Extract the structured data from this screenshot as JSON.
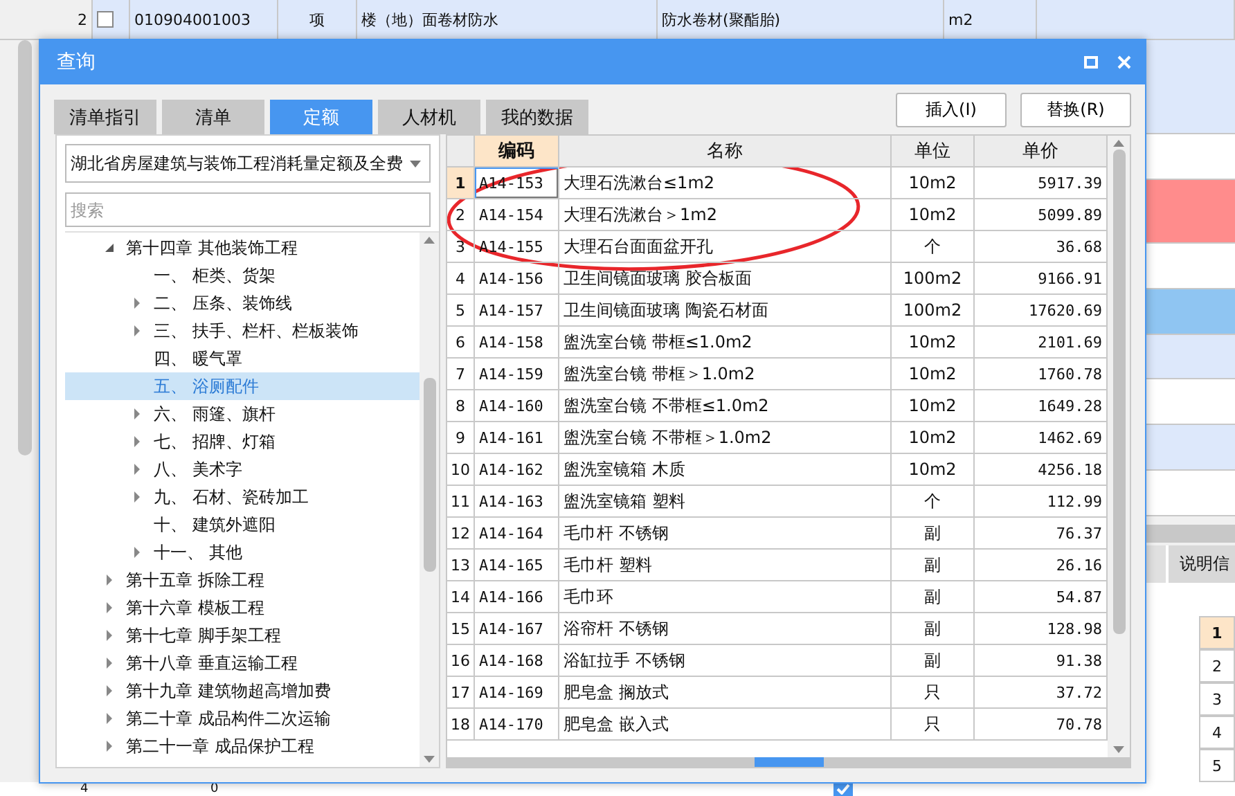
{
  "background": {
    "top_row": {
      "number": "2",
      "checked": false,
      "code": "010904001003",
      "type": "项",
      "name": "楼（地）面卷材防水",
      "feature": "防水卷材(聚酯胎)",
      "unit": "m2"
    },
    "side_rows": [
      {
        "color": "#dde8fb"
      },
      {
        "color": "#ffffff"
      },
      {
        "color": "#ff8c8c"
      },
      {
        "color": "#ffffff"
      },
      {
        "color": "#8fc5f2"
      },
      {
        "color": "#dde8fb"
      },
      {
        "color": "#ffffff"
      },
      {
        "color": "#dde8fb"
      },
      {
        "color": "#ffffff"
      }
    ],
    "side_tab": "说明信",
    "side_numbers": [
      {
        "label": "1",
        "selected": true
      },
      {
        "label": "2",
        "selected": false
      },
      {
        "label": "3",
        "selected": false
      },
      {
        "label": "4",
        "selected": false
      },
      {
        "label": "5",
        "selected": false
      }
    ],
    "bottom_row": {
      "number": "4",
      "value": "0",
      "checked": true
    }
  },
  "dialog": {
    "title": "查询",
    "tabs": [
      {
        "label": "清单指引",
        "selected": false
      },
      {
        "label": "清单",
        "selected": false
      },
      {
        "label": "定额",
        "selected": true
      },
      {
        "label": "人材机",
        "selected": false
      },
      {
        "label": "我的数据",
        "selected": false
      }
    ],
    "buttons": [
      "插入(I)",
      "替换(R)"
    ],
    "library": "湖北省房屋建筑与装饰工程消耗量定额及全费",
    "search": {
      "placeholder": "搜索"
    },
    "tree": [
      {
        "label": "第十四章 其他装饰工程",
        "expanded": true,
        "selected": false,
        "children": [
          {
            "label": "一、 柜类、货架",
            "selected": false
          },
          {
            "label": "二、 压条、装饰线",
            "expanded": false,
            "selected": false
          },
          {
            "label": "三、 扶手、栏杆、栏板装饰",
            "expanded": false,
            "selected": false
          },
          {
            "label": "四、 暖气罩",
            "selected": false
          },
          {
            "label": "五、 浴厕配件",
            "selected": true
          },
          {
            "label": "六、 雨篷、旗杆",
            "expanded": false,
            "selected": false
          },
          {
            "label": "七、 招牌、灯箱",
            "expanded": false,
            "selected": false
          },
          {
            "label": "八、 美术字",
            "expanded": false,
            "selected": false
          },
          {
            "label": "九、 石材、瓷砖加工",
            "expanded": false,
            "selected": false
          },
          {
            "label": "十、 建筑外遮阳",
            "selected": false
          },
          {
            "label": "十一、 其他",
            "expanded": false,
            "selected": false
          }
        ]
      },
      {
        "label": "第十五章 拆除工程",
        "expanded": false,
        "selected": false
      },
      {
        "label": "第十六章 模板工程",
        "expanded": false,
        "selected": false
      },
      {
        "label": "第十七章 脚手架工程",
        "expanded": false,
        "selected": false
      },
      {
        "label": "第十八章 垂直运输工程",
        "expanded": false,
        "selected": false
      },
      {
        "label": "第十九章 建筑物超高增加费",
        "expanded": false,
        "selected": false
      },
      {
        "label": "第二十章 成品构件二次运输",
        "expanded": false,
        "selected": false
      },
      {
        "label": "第二十一章 成品保护工程",
        "expanded": false,
        "selected": false
      }
    ],
    "table": {
      "columns": [
        {
          "label": "编码",
          "selected": true
        },
        {
          "label": "名称",
          "selected": false
        },
        {
          "label": "单位",
          "selected": false
        },
        {
          "label": "单价",
          "selected": false
        }
      ],
      "rows": [
        {
          "n": "1",
          "code": "A14-153",
          "name": "大理石洗漱台≤1m2",
          "unit": "10m2",
          "price": "5917.39",
          "selected": true
        },
        {
          "n": "2",
          "code": "A14-154",
          "name": "大理石洗漱台＞1m2",
          "unit": "10m2",
          "price": "5099.89",
          "selected": false
        },
        {
          "n": "3",
          "code": "A14-155",
          "name": "大理石台面面盆开孔",
          "unit": "个",
          "price": "36.68",
          "selected": false
        },
        {
          "n": "4",
          "code": "A14-156",
          "name": "卫生间镜面玻璃 胶合板面",
          "unit": "100m2",
          "price": "9166.91",
          "selected": false
        },
        {
          "n": "5",
          "code": "A14-157",
          "name": "卫生间镜面玻璃 陶瓷石材面",
          "unit": "100m2",
          "price": "17620.69",
          "selected": false
        },
        {
          "n": "6",
          "code": "A14-158",
          "name": "盥洗室台镜 带框≤1.0m2",
          "unit": "10m2",
          "price": "2101.69",
          "selected": false
        },
        {
          "n": "7",
          "code": "A14-159",
          "name": "盥洗室台镜 带框＞1.0m2",
          "unit": "10m2",
          "price": "1760.78",
          "selected": false
        },
        {
          "n": "8",
          "code": "A14-160",
          "name": "盥洗室台镜 不带框≤1.0m2",
          "unit": "10m2",
          "price": "1649.28",
          "selected": false
        },
        {
          "n": "9",
          "code": "A14-161",
          "name": "盥洗室台镜 不带框＞1.0m2",
          "unit": "10m2",
          "price": "1462.69",
          "selected": false
        },
        {
          "n": "10",
          "code": "A14-162",
          "name": "盥洗室镜箱 木质",
          "unit": "10m2",
          "price": "4256.18",
          "selected": false
        },
        {
          "n": "11",
          "code": "A14-163",
          "name": "盥洗室镜箱 塑料",
          "unit": "个",
          "price": "112.99",
          "selected": false
        },
        {
          "n": "12",
          "code": "A14-164",
          "name": "毛巾杆 不锈钢",
          "unit": "副",
          "price": "76.37",
          "selected": false
        },
        {
          "n": "13",
          "code": "A14-165",
          "name": "毛巾杆 塑料",
          "unit": "副",
          "price": "26.16",
          "selected": false
        },
        {
          "n": "14",
          "code": "A14-166",
          "name": "毛巾环",
          "unit": "副",
          "price": "54.87",
          "selected": false
        },
        {
          "n": "15",
          "code": "A14-167",
          "name": "浴帘杆 不锈钢",
          "unit": "副",
          "price": "128.98",
          "selected": false
        },
        {
          "n": "16",
          "code": "A14-168",
          "name": "浴缸拉手 不锈钢",
          "unit": "副",
          "price": "91.38",
          "selected": false
        },
        {
          "n": "17",
          "code": "A14-169",
          "name": "肥皂盒 搁放式",
          "unit": "只",
          "price": "37.72",
          "selected": false
        },
        {
          "n": "18",
          "code": "A14-170",
          "name": "肥皂盒 嵌入式",
          "unit": "只",
          "price": "70.78",
          "selected": false
        }
      ]
    }
  }
}
